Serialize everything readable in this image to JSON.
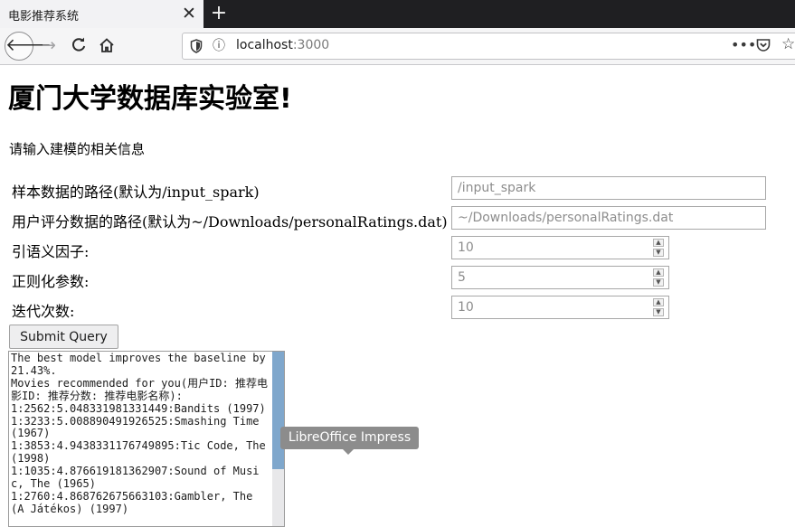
{
  "browser": {
    "tab_title": "电影推荐系统",
    "tab_close_glyph": "✕",
    "new_tab_glyph": "+",
    "url_host": "localhost",
    "url_port": ":3000"
  },
  "page": {
    "title": "厦门大学数据库实验室!",
    "intro": "请输入建模的相关信息",
    "fields": [
      {
        "label": "样本数据的路径(默认为/input_spark)",
        "placeholder": "/input_spark"
      },
      {
        "label": "用户评分数据的路径(默认为~/Downloads/personalRatings.dat)",
        "placeholder": "~/Downloads/personalRatings.dat"
      },
      {
        "label": "引语义因子:",
        "value": "10"
      },
      {
        "label": "正则化参数:",
        "value": "5"
      },
      {
        "label": "迭代次数:",
        "value": "10"
      }
    ],
    "submit_label": "Submit Query",
    "output": "The best model improves the baseline by 21.43%.\nMovies recommended for you(用户ID: 推荐电影ID: 推荐分数: 推荐电影名称):\n1:2562:5.048331981331449:Bandits (1997)\n1:3233:5.008890491926525:Smashing Time (1967)\n1:3853:4.9438331176749895:Tic Code, The (1998)\n1:1035:4.876619181362907:Sound of Music, The (1965)\n1:2760:4.868762675663103:Gambler, The (A Játékos) (1997)"
  },
  "tooltip": "LibreOffice Impress",
  "colors": {
    "scroll_thumb": "#7fa7cc",
    "tab_bar": "#1f1f22"
  }
}
